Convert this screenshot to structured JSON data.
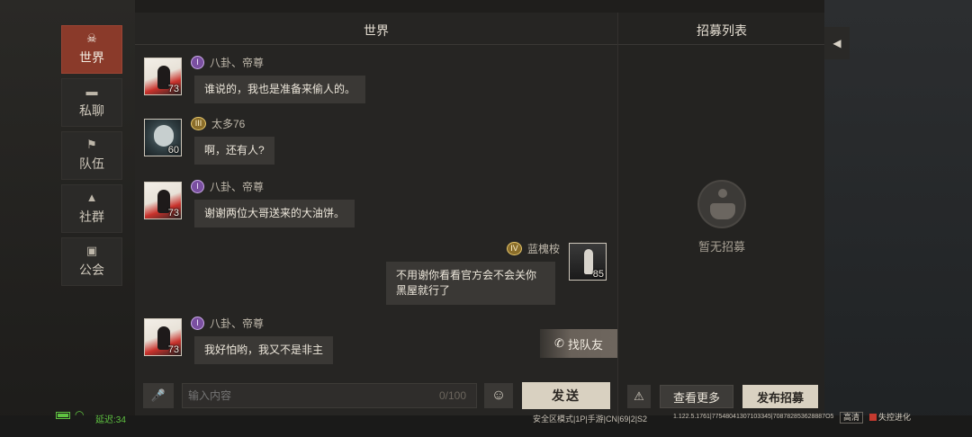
{
  "nav": {
    "items": [
      {
        "label": "世界",
        "icon": "skull-icon",
        "active": true
      },
      {
        "label": "私聊",
        "icon": "chat-icon",
        "active": false
      },
      {
        "label": "队伍",
        "icon": "flag-icon",
        "active": false
      },
      {
        "label": "社群",
        "icon": "campfire-icon",
        "active": false
      },
      {
        "label": "公会",
        "icon": "banner-icon",
        "active": false
      }
    ]
  },
  "chat": {
    "title": "世界",
    "messages": [
      {
        "name": "八卦、帝尊",
        "badge": "I",
        "level": "73",
        "text": "谁说的，我也是准备来偷人的。",
        "side": "left"
      },
      {
        "name": "太多76",
        "badge": "III",
        "level": "60",
        "text": "啊，还有人?",
        "side": "left"
      },
      {
        "name": "八卦、帝尊",
        "badge": "I",
        "level": "73",
        "text": "谢谢两位大哥送来的大油饼。",
        "side": "left"
      },
      {
        "name": "蓝槐桉",
        "badge": "IV",
        "level": "85",
        "text": "不用谢你看看官方会不会关你黑屋就行了",
        "side": "right"
      },
      {
        "name": "八卦、帝尊",
        "badge": "I",
        "level": "73",
        "text": "我好怕哟，我又不是非主",
        "side": "left"
      }
    ],
    "find_team_label": "找队友",
    "input_placeholder": "输入内容",
    "char_counter": "0/100",
    "send_label": "发送"
  },
  "recruit": {
    "title": "招募列表",
    "empty_text": "暂无招募",
    "view_more_label": "查看更多",
    "publish_label": "发布招募"
  },
  "status": {
    "latency": "延迟:34",
    "server_info": "安全区模式|1P|手游|CN|69|2|S2",
    "build_info": "1.122.5.1761|77548041307103345|708782853628887O5",
    "quality": "高清",
    "logo_text": "失控进化"
  },
  "colors": {
    "active_tab": "#8a3a2a",
    "primary_button": "#d9d1c1",
    "status_green": "#5fc241"
  }
}
